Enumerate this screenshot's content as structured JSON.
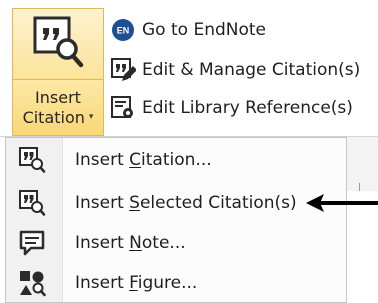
{
  "colors": {
    "accent_fill": "#fce39a",
    "accent_border": "#e3b65a",
    "icon_dark": "#2b2b2b",
    "endnote_blue": "#1d4f91"
  },
  "ribbon": {
    "insert_citation": {
      "label_line1": "Insert",
      "label_line2": "Citation",
      "caret": "▾",
      "icon": "insert-citation-large-icon"
    },
    "go_to_endnote": {
      "label": "Go to EndNote",
      "icon": "endnote-logo-icon",
      "logo_text": "EN"
    },
    "edit_manage_citations": {
      "label": "Edit & Manage Citation(s)",
      "icon": "edit-citation-icon"
    },
    "edit_library_reference": {
      "label": "Edit Library Reference(s)",
      "icon": "edit-library-reference-icon"
    }
  },
  "menu": {
    "items": [
      {
        "pre": "Insert ",
        "key": "C",
        "post": "itation...",
        "icon": "insert-citation-icon"
      },
      {
        "pre": "Insert ",
        "key": "S",
        "post": "elected Citation(s)",
        "icon": "insert-selected-citation-icon"
      },
      {
        "pre": "Insert ",
        "key": "N",
        "post": "ote...",
        "icon": "insert-note-icon"
      },
      {
        "pre": "Insert ",
        "key": "F",
        "post": "igure...",
        "icon": "insert-figure-icon"
      }
    ]
  },
  "annotation": {
    "icon": "pointer-arrow-icon"
  }
}
